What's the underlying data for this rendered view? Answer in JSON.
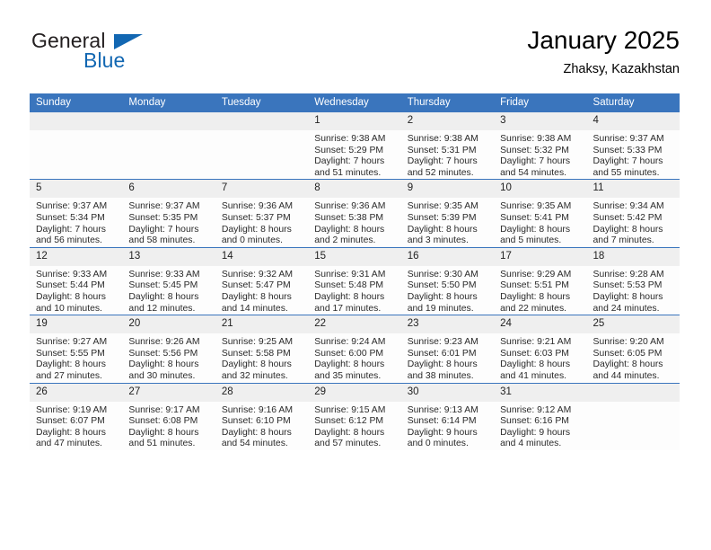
{
  "logo": {
    "word_one": "General",
    "word_two": "Blue",
    "triangle_color": "#1267b2",
    "text_color": "#231f20"
  },
  "header": {
    "title": "January 2025",
    "location": "Zhaksy, Kazakhstan"
  },
  "theme": {
    "header_blue": "#3a75bd",
    "daynum_band": "#efefef",
    "cell_bg": "#fdfdfd",
    "text": "#2a2a2a"
  },
  "calendar": {
    "weekdays": [
      "Sunday",
      "Monday",
      "Tuesday",
      "Wednesday",
      "Thursday",
      "Friday",
      "Saturday"
    ],
    "weeks": [
      [
        {
          "day": "",
          "sunrise": "",
          "sunset": "",
          "daylight_line1": "",
          "daylight_line2": "",
          "blank": true
        },
        {
          "day": "",
          "sunrise": "",
          "sunset": "",
          "daylight_line1": "",
          "daylight_line2": "",
          "blank": true
        },
        {
          "day": "",
          "sunrise": "",
          "sunset": "",
          "daylight_line1": "",
          "daylight_line2": "",
          "blank": true
        },
        {
          "day": "1",
          "sunrise": "Sunrise: 9:38 AM",
          "sunset": "Sunset: 5:29 PM",
          "daylight_line1": "Daylight: 7 hours",
          "daylight_line2": "and 51 minutes."
        },
        {
          "day": "2",
          "sunrise": "Sunrise: 9:38 AM",
          "sunset": "Sunset: 5:31 PM",
          "daylight_line1": "Daylight: 7 hours",
          "daylight_line2": "and 52 minutes."
        },
        {
          "day": "3",
          "sunrise": "Sunrise: 9:38 AM",
          "sunset": "Sunset: 5:32 PM",
          "daylight_line1": "Daylight: 7 hours",
          "daylight_line2": "and 54 minutes."
        },
        {
          "day": "4",
          "sunrise": "Sunrise: 9:37 AM",
          "sunset": "Sunset: 5:33 PM",
          "daylight_line1": "Daylight: 7 hours",
          "daylight_line2": "and 55 minutes."
        }
      ],
      [
        {
          "day": "5",
          "sunrise": "Sunrise: 9:37 AM",
          "sunset": "Sunset: 5:34 PM",
          "daylight_line1": "Daylight: 7 hours",
          "daylight_line2": "and 56 minutes."
        },
        {
          "day": "6",
          "sunrise": "Sunrise: 9:37 AM",
          "sunset": "Sunset: 5:35 PM",
          "daylight_line1": "Daylight: 7 hours",
          "daylight_line2": "and 58 minutes."
        },
        {
          "day": "7",
          "sunrise": "Sunrise: 9:36 AM",
          "sunset": "Sunset: 5:37 PM",
          "daylight_line1": "Daylight: 8 hours",
          "daylight_line2": "and 0 minutes."
        },
        {
          "day": "8",
          "sunrise": "Sunrise: 9:36 AM",
          "sunset": "Sunset: 5:38 PM",
          "daylight_line1": "Daylight: 8 hours",
          "daylight_line2": "and 2 minutes."
        },
        {
          "day": "9",
          "sunrise": "Sunrise: 9:35 AM",
          "sunset": "Sunset: 5:39 PM",
          "daylight_line1": "Daylight: 8 hours",
          "daylight_line2": "and 3 minutes."
        },
        {
          "day": "10",
          "sunrise": "Sunrise: 9:35 AM",
          "sunset": "Sunset: 5:41 PM",
          "daylight_line1": "Daylight: 8 hours",
          "daylight_line2": "and 5 minutes."
        },
        {
          "day": "11",
          "sunrise": "Sunrise: 9:34 AM",
          "sunset": "Sunset: 5:42 PM",
          "daylight_line1": "Daylight: 8 hours",
          "daylight_line2": "and 7 minutes."
        }
      ],
      [
        {
          "day": "12",
          "sunrise": "Sunrise: 9:33 AM",
          "sunset": "Sunset: 5:44 PM",
          "daylight_line1": "Daylight: 8 hours",
          "daylight_line2": "and 10 minutes."
        },
        {
          "day": "13",
          "sunrise": "Sunrise: 9:33 AM",
          "sunset": "Sunset: 5:45 PM",
          "daylight_line1": "Daylight: 8 hours",
          "daylight_line2": "and 12 minutes."
        },
        {
          "day": "14",
          "sunrise": "Sunrise: 9:32 AM",
          "sunset": "Sunset: 5:47 PM",
          "daylight_line1": "Daylight: 8 hours",
          "daylight_line2": "and 14 minutes."
        },
        {
          "day": "15",
          "sunrise": "Sunrise: 9:31 AM",
          "sunset": "Sunset: 5:48 PM",
          "daylight_line1": "Daylight: 8 hours",
          "daylight_line2": "and 17 minutes."
        },
        {
          "day": "16",
          "sunrise": "Sunrise: 9:30 AM",
          "sunset": "Sunset: 5:50 PM",
          "daylight_line1": "Daylight: 8 hours",
          "daylight_line2": "and 19 minutes."
        },
        {
          "day": "17",
          "sunrise": "Sunrise: 9:29 AM",
          "sunset": "Sunset: 5:51 PM",
          "daylight_line1": "Daylight: 8 hours",
          "daylight_line2": "and 22 minutes."
        },
        {
          "day": "18",
          "sunrise": "Sunrise: 9:28 AM",
          "sunset": "Sunset: 5:53 PM",
          "daylight_line1": "Daylight: 8 hours",
          "daylight_line2": "and 24 minutes."
        }
      ],
      [
        {
          "day": "19",
          "sunrise": "Sunrise: 9:27 AM",
          "sunset": "Sunset: 5:55 PM",
          "daylight_line1": "Daylight: 8 hours",
          "daylight_line2": "and 27 minutes."
        },
        {
          "day": "20",
          "sunrise": "Sunrise: 9:26 AM",
          "sunset": "Sunset: 5:56 PM",
          "daylight_line1": "Daylight: 8 hours",
          "daylight_line2": "and 30 minutes."
        },
        {
          "day": "21",
          "sunrise": "Sunrise: 9:25 AM",
          "sunset": "Sunset: 5:58 PM",
          "daylight_line1": "Daylight: 8 hours",
          "daylight_line2": "and 32 minutes."
        },
        {
          "day": "22",
          "sunrise": "Sunrise: 9:24 AM",
          "sunset": "Sunset: 6:00 PM",
          "daylight_line1": "Daylight: 8 hours",
          "daylight_line2": "and 35 minutes."
        },
        {
          "day": "23",
          "sunrise": "Sunrise: 9:23 AM",
          "sunset": "Sunset: 6:01 PM",
          "daylight_line1": "Daylight: 8 hours",
          "daylight_line2": "and 38 minutes."
        },
        {
          "day": "24",
          "sunrise": "Sunrise: 9:21 AM",
          "sunset": "Sunset: 6:03 PM",
          "daylight_line1": "Daylight: 8 hours",
          "daylight_line2": "and 41 minutes."
        },
        {
          "day": "25",
          "sunrise": "Sunrise: 9:20 AM",
          "sunset": "Sunset: 6:05 PM",
          "daylight_line1": "Daylight: 8 hours",
          "daylight_line2": "and 44 minutes."
        }
      ],
      [
        {
          "day": "26",
          "sunrise": "Sunrise: 9:19 AM",
          "sunset": "Sunset: 6:07 PM",
          "daylight_line1": "Daylight: 8 hours",
          "daylight_line2": "and 47 minutes."
        },
        {
          "day": "27",
          "sunrise": "Sunrise: 9:17 AM",
          "sunset": "Sunset: 6:08 PM",
          "daylight_line1": "Daylight: 8 hours",
          "daylight_line2": "and 51 minutes."
        },
        {
          "day": "28",
          "sunrise": "Sunrise: 9:16 AM",
          "sunset": "Sunset: 6:10 PM",
          "daylight_line1": "Daylight: 8 hours",
          "daylight_line2": "and 54 minutes."
        },
        {
          "day": "29",
          "sunrise": "Sunrise: 9:15 AM",
          "sunset": "Sunset: 6:12 PM",
          "daylight_line1": "Daylight: 8 hours",
          "daylight_line2": "and 57 minutes."
        },
        {
          "day": "30",
          "sunrise": "Sunrise: 9:13 AM",
          "sunset": "Sunset: 6:14 PM",
          "daylight_line1": "Daylight: 9 hours",
          "daylight_line2": "and 0 minutes."
        },
        {
          "day": "31",
          "sunrise": "Sunrise: 9:12 AM",
          "sunset": "Sunset: 6:16 PM",
          "daylight_line1": "Daylight: 9 hours",
          "daylight_line2": "and 4 minutes."
        },
        {
          "day": "",
          "sunrise": "",
          "sunset": "",
          "daylight_line1": "",
          "daylight_line2": "",
          "blank": true
        }
      ]
    ]
  }
}
